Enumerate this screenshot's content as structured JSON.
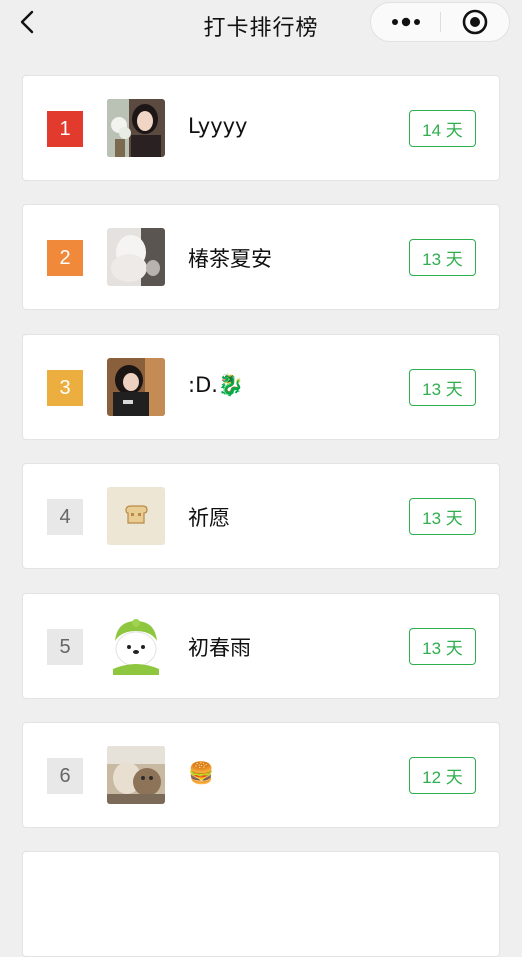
{
  "header": {
    "title": "打卡排行榜"
  },
  "colors": {
    "rank_1": "#e23b2e",
    "rank_2": "#f08a3a",
    "rank_3": "#ecae3e",
    "rank_other": "#e8e8e8",
    "days_green": "#2fae4e"
  },
  "ranking": [
    {
      "rank": "1",
      "name": "Lyyyy",
      "days": "14 天"
    },
    {
      "rank": "2",
      "name": "椿茶夏安",
      "days": "13 天"
    },
    {
      "rank": "3",
      "name": ":D.🐉",
      "days": "13 天"
    },
    {
      "rank": "4",
      "name": "祈愿",
      "days": "13 天"
    },
    {
      "rank": "5",
      "name": "初春雨",
      "days": "13 天"
    },
    {
      "rank": "6",
      "name": "🍔",
      "days": "12 天"
    }
  ]
}
